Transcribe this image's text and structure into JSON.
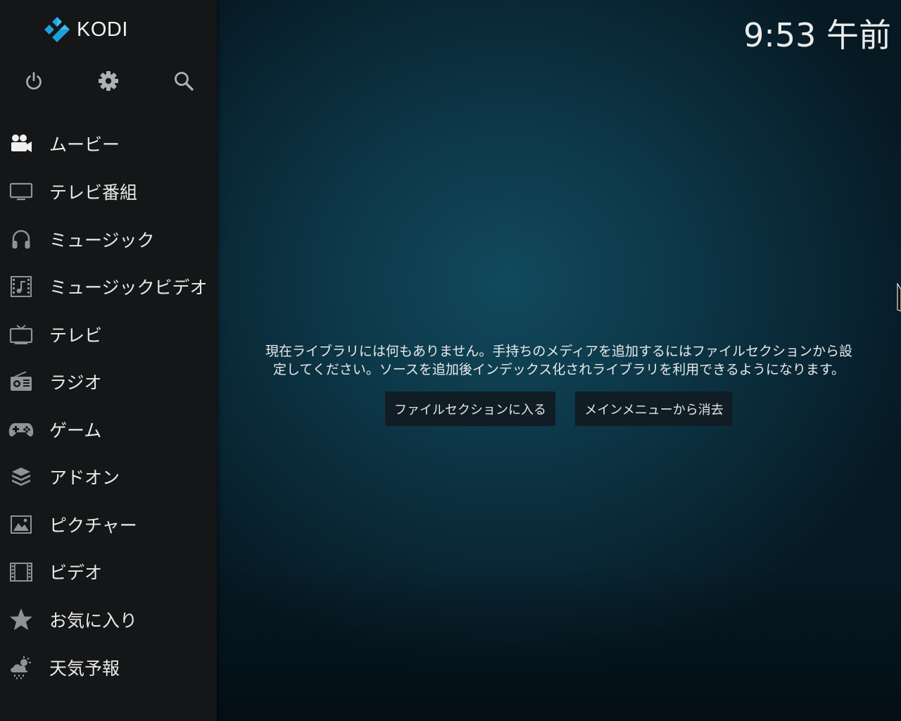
{
  "app": {
    "logo_text": "KODI",
    "clock": "9:53 午前"
  },
  "top_buttons": [
    {
      "icon": "power-icon"
    },
    {
      "icon": "gear-icon"
    },
    {
      "icon": "search-icon"
    }
  ],
  "menu": [
    {
      "label": "ムービー",
      "icon": "movies-icon"
    },
    {
      "label": "テレビ番組",
      "icon": "tv-shows-icon"
    },
    {
      "label": "ミュージック",
      "icon": "headphones-icon"
    },
    {
      "label": "ミュージックビデオ",
      "icon": "music-video-icon"
    },
    {
      "label": "テレビ",
      "icon": "tv-icon"
    },
    {
      "label": "ラジオ",
      "icon": "radio-icon"
    },
    {
      "label": "ゲーム",
      "icon": "gamepad-icon"
    },
    {
      "label": "アドオン",
      "icon": "addon-box-icon"
    },
    {
      "label": "ピクチャー",
      "icon": "picture-icon"
    },
    {
      "label": "ビデオ",
      "icon": "film-strip-icon"
    },
    {
      "label": "お気に入り",
      "icon": "star-icon"
    },
    {
      "label": "天気予報",
      "icon": "weather-icon"
    }
  ],
  "message": {
    "line1": "現在ライブラリには何もありません。手持ちのメディアを追加するにはファイルセクションから設",
    "line2": "定してください。ソースを追加後インデックス化されライブラリを利用できるようになります。"
  },
  "buttons": {
    "enter_files": "ファイルセクションに入る",
    "remove_from_menu": "メインメニューから消去"
  },
  "colors": {
    "sidebar": "#141617",
    "background": "#0d3a4b",
    "logo_blue": "#1f9ed9",
    "icon_gray": "#9fa3a5",
    "button": "#101d24"
  }
}
